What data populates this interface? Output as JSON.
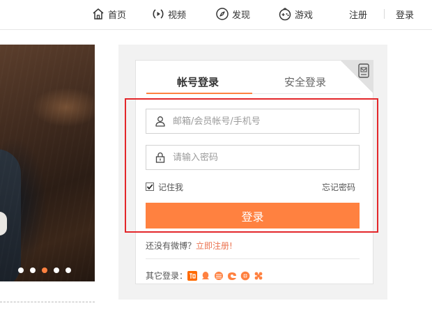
{
  "nav": {
    "home": "首页",
    "video": "视频",
    "discover": "发现",
    "games": "游戏",
    "register": "注册",
    "login": "登录"
  },
  "icons": {
    "home": "home-icon",
    "video": "video-play-icon",
    "discover": "compass-icon",
    "games": "gamepad-icon",
    "qr": "qr-login-icon",
    "user": "user-icon",
    "lock": "lock-icon",
    "check": "checkmark-icon"
  },
  "carousel": {
    "dot_count": 5,
    "active_dot": 3
  },
  "login": {
    "tab_account": "帐号登录",
    "tab_secure": "安全登录",
    "username_placeholder": "邮箱/会员帐号/手机号",
    "password_placeholder": "请输入密码",
    "remember_label": "记住我",
    "remember_checked": true,
    "forgot_label": "忘记密码",
    "submit_label": "登录",
    "no_account_text": "还没有微博？",
    "register_link": "立即注册!",
    "other_login_label": "其它登录："
  },
  "social_logins": [
    "taobao",
    "qq",
    "sohu",
    "netease",
    "sina",
    "weixin"
  ],
  "colors": {
    "accent": "#ff8140",
    "link": "#eb7350",
    "highlight_box": "#e3262a",
    "panel_bg": "#f2f2f2"
  }
}
